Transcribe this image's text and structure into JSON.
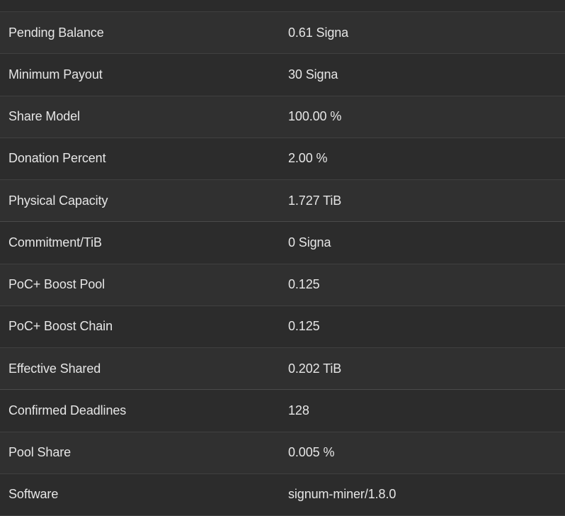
{
  "rows": [
    {
      "label": "Pending Balance",
      "value": "0.61 Signa"
    },
    {
      "label": "Minimum Payout",
      "value": "30 Signa"
    },
    {
      "label": "Share Model",
      "value": "100.00 %"
    },
    {
      "label": "Donation Percent",
      "value": "2.00 %"
    },
    {
      "label": "Physical Capacity",
      "value": "1.727 TiB"
    },
    {
      "label": "Commitment/TiB",
      "value": "0 Signa"
    },
    {
      "label": "PoC+ Boost Pool",
      "value": "0.125"
    },
    {
      "label": "PoC+ Boost Chain",
      "value": "0.125"
    },
    {
      "label": "Effective Shared",
      "value": "0.202 TiB"
    },
    {
      "label": "Confirmed Deadlines",
      "value": "128"
    },
    {
      "label": "Pool Share",
      "value": "0.005 %"
    },
    {
      "label": "Software",
      "value": "signum-miner/1.8.0"
    }
  ]
}
